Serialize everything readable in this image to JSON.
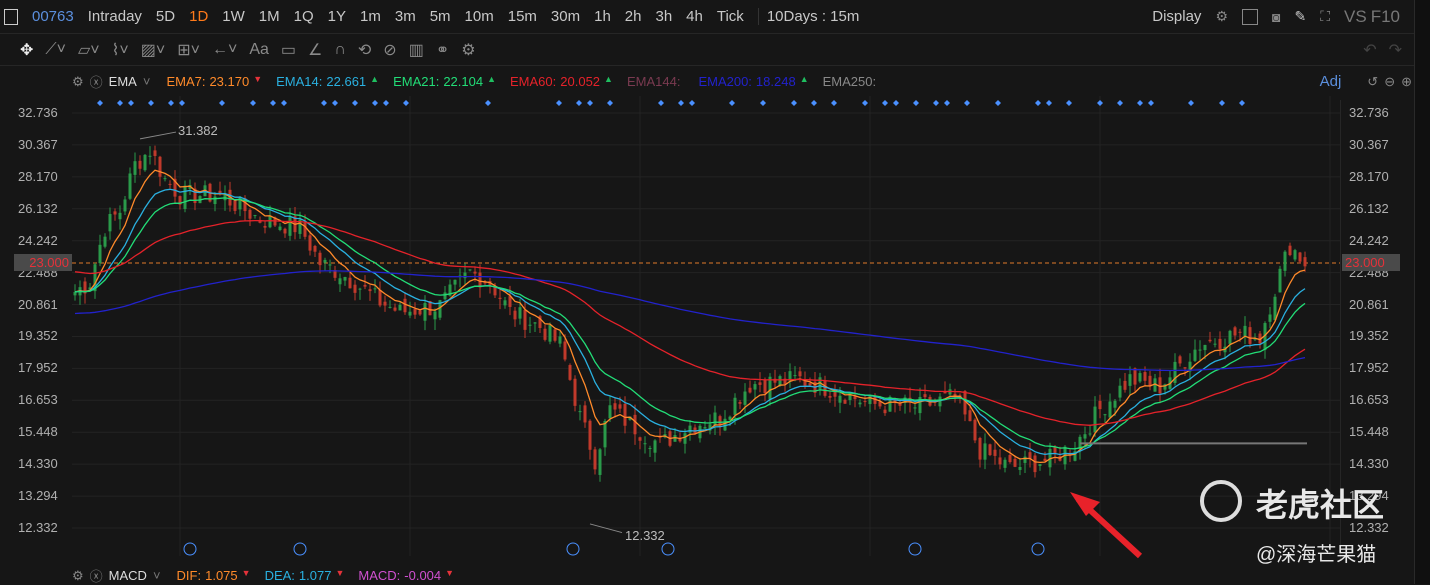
{
  "toolbar": {
    "symbol": "00763",
    "timeframes": [
      "Intraday",
      "5D",
      "1D",
      "1W",
      "1M",
      "1Q",
      "1Y",
      "1m",
      "3m",
      "5m",
      "10m",
      "15m",
      "30m",
      "1h",
      "2h",
      "3h",
      "4h",
      "Tick"
    ],
    "active": "1D",
    "range": "10Days : 15m",
    "display": "Display",
    "vs": "VS",
    "f10": "F10"
  },
  "drawing_tools": {
    "text_tool": "Aa"
  },
  "indicator": {
    "name": "EMA",
    "adj": "Adj",
    "items": [
      {
        "label": "EMA7:",
        "value": "23.170",
        "trend": "down",
        "color": "#ff8a2a"
      },
      {
        "label": "EMA14:",
        "value": "22.661",
        "trend": "up",
        "color": "#2ab0e0"
      },
      {
        "label": "EMA21:",
        "value": "22.104",
        "trend": "up",
        "color": "#22dd77"
      },
      {
        "label": "EMA60:",
        "value": "20.052",
        "trend": "up",
        "color": "#e5222a"
      },
      {
        "label": "EMA144:",
        "value": "",
        "trend": "",
        "color": "#7a3a50"
      },
      {
        "label": "EMA200:",
        "value": "18.248",
        "trend": "up",
        "color": "#2222cc"
      },
      {
        "label": "EMA250:",
        "value": "",
        "trend": "",
        "color": "#888888"
      }
    ]
  },
  "macd": {
    "name": "MACD",
    "items": [
      {
        "label": "DIF:",
        "value": "1.075",
        "trend": "down",
        "color": "#ff8a2a"
      },
      {
        "label": "DEA:",
        "value": "1.077",
        "trend": "down",
        "color": "#2ab0e0"
      },
      {
        "label": "MACD:",
        "value": "-0.004",
        "trend": "down",
        "color": "#d050d0"
      }
    ]
  },
  "price_axis": [
    "32.736",
    "30.367",
    "28.170",
    "26.132",
    "24.242",
    "22.488",
    "20.861",
    "19.352",
    "17.952",
    "16.653",
    "15.448",
    "14.330",
    "13.294",
    "12.332"
  ],
  "current_price": "23.000",
  "annotations": {
    "high": "31.382",
    "low": "12.332"
  },
  "watermark": {
    "brand": "老虎社区",
    "author": "@深海芒果猫"
  },
  "chart_data": {
    "type": "candlestick",
    "ylim": [
      12.332,
      32.736
    ],
    "scale": "log",
    "close_path": [
      [
        0,
        21.5
      ],
      [
        3,
        22
      ],
      [
        6,
        25
      ],
      [
        9,
        26
      ],
      [
        12,
        29
      ],
      [
        15,
        30
      ],
      [
        18,
        28
      ],
      [
        21,
        27
      ],
      [
        29,
        27
      ],
      [
        37,
        25.5
      ],
      [
        45,
        25
      ],
      [
        49,
        23
      ],
      [
        53,
        22.5
      ],
      [
        61,
        21
      ],
      [
        65,
        20.5
      ],
      [
        73,
        20.8
      ],
      [
        79,
        22.5
      ],
      [
        83,
        22
      ],
      [
        87,
        20.5
      ],
      [
        93,
        19.8
      ],
      [
        97,
        19
      ],
      [
        101,
        16
      ],
      [
        104,
        14.5
      ],
      [
        107,
        16.3
      ],
      [
        113,
        15.5
      ],
      [
        117,
        15
      ],
      [
        123,
        15.7
      ],
      [
        129,
        16
      ],
      [
        135,
        17.3
      ],
      [
        145,
        17.5
      ],
      [
        153,
        17
      ],
      [
        159,
        16.5
      ],
      [
        169,
        16.4
      ],
      [
        176,
        16.8
      ],
      [
        181,
        14.8
      ],
      [
        187,
        14.2
      ],
      [
        195,
        14.5
      ],
      [
        200,
        15
      ],
      [
        205,
        16.3
      ],
      [
        211,
        17.5
      ],
      [
        217,
        17.2
      ],
      [
        225,
        19
      ],
      [
        233,
        19.5
      ],
      [
        237,
        19.3
      ],
      [
        243,
        24
      ],
      [
        246,
        23
      ]
    ]
  }
}
